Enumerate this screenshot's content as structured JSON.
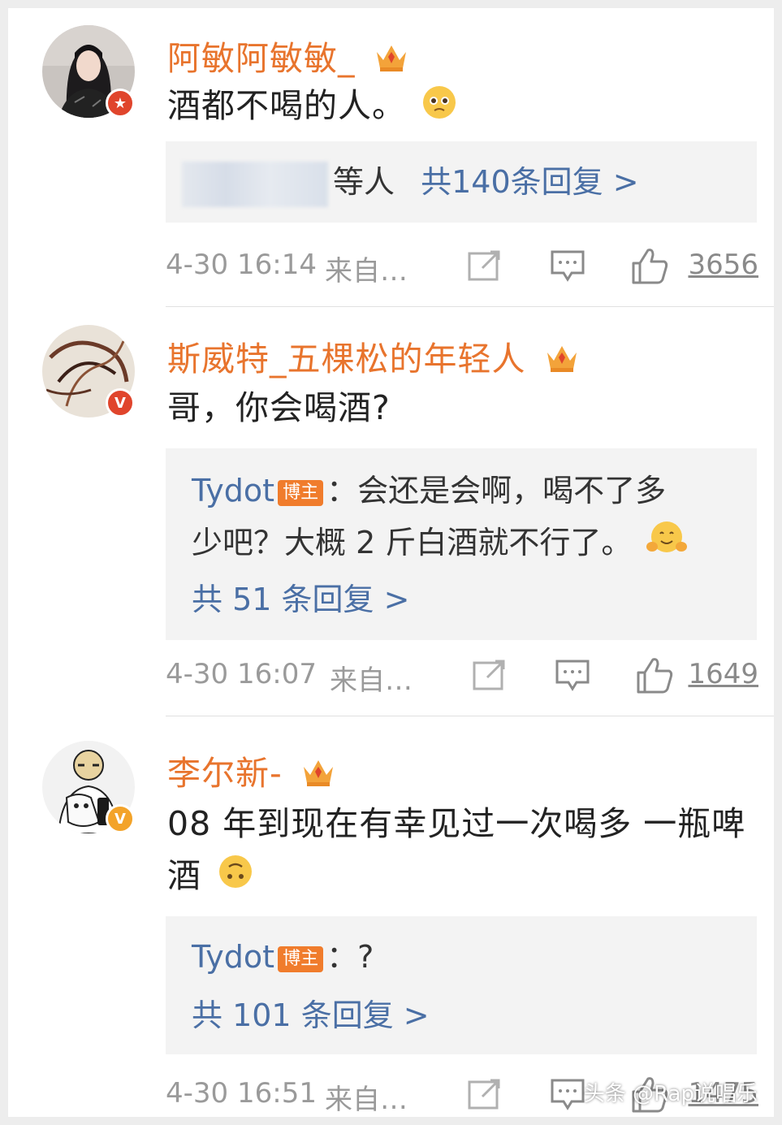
{
  "colors": {
    "username": "#e8742d",
    "link": "#4a6fa5",
    "tag": "#f07c2c"
  },
  "comments": [
    {
      "username": "阿敏阿敏敏_",
      "text": "酒都不喝的人。",
      "emoji": "pleading-face",
      "badge_icon": "star-icon",
      "reply_summary": {
        "blurred_names": true,
        "suffix": "等人",
        "link": "共140条回复 >"
      },
      "time": "4-30 16:14",
      "source": "来自…",
      "likes": "3656"
    },
    {
      "username": "斯威特_五棵松的年轻人",
      "text": "哥，你会喝酒?",
      "badge_icon": "verified-v-icon",
      "reply": {
        "author": "Tydot",
        "tag": "博主",
        "text_line1": "：会还是会啊，喝不了多",
        "text_line2": "少吧？大概 2 斤白酒就不行了。",
        "emoji": "hugging-face"
      },
      "reply_link": "共 51 条回复 >",
      "time": "4-30 16:07",
      "source": "来自…",
      "likes": "1649"
    },
    {
      "username": "李尔新-",
      "text_line1": "08 年到现在有幸见过一次喝多 一瓶啤",
      "text_line2": "酒",
      "emoji": "upside-down-face",
      "badge_icon": "verified-v-icon",
      "reply": {
        "author": "Tydot",
        "tag": "博主",
        "text": "：?"
      },
      "reply_link": "共 101 条回复 >",
      "time": "4-30 16:51",
      "source": "来自…",
      "likes": "1475"
    }
  ],
  "watermark": "头条 @Rap说唱乐"
}
